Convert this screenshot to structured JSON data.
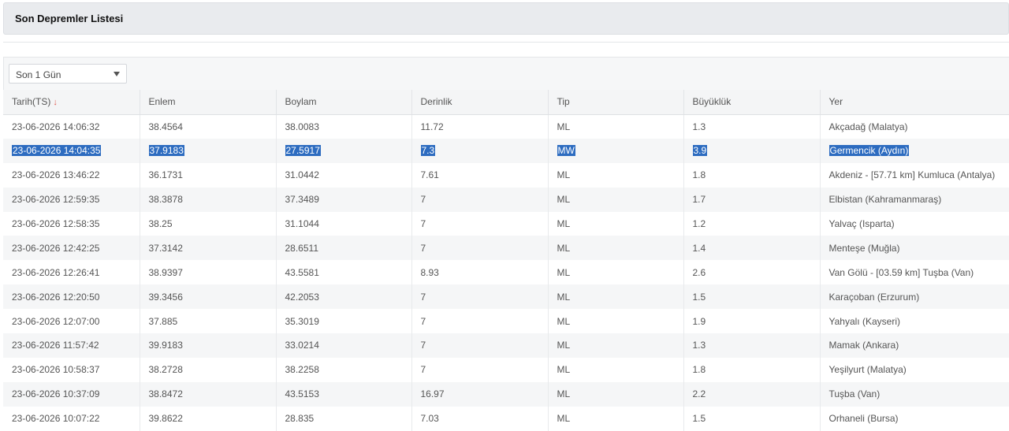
{
  "page": {
    "title": "Son Depremler Listesi"
  },
  "filter": {
    "selected": "Son 1 Gün"
  },
  "table": {
    "columns": [
      "Tarih(TS)",
      "Enlem",
      "Boylam",
      "Derinlik",
      "Tip",
      "Büyüklük",
      "Yer"
    ],
    "sort_indicator": "↓",
    "selected_row_index": 1,
    "colors": {
      "selection": "#2d6cc0",
      "sort_arrow": "#e05a4f"
    },
    "rows": [
      [
        "23-06-2026 14:06:32",
        "38.4564",
        "38.0083",
        "11.72",
        "ML",
        "1.3",
        "Akçadağ (Malatya)"
      ],
      [
        "23-06-2026 14:04:35",
        "37.9183",
        "27.5917",
        "7.3",
        "MW",
        "3.9",
        "Germencik (Aydın)"
      ],
      [
        "23-06-2026 13:46:22",
        "36.1731",
        "31.0442",
        "7.61",
        "ML",
        "1.8",
        "Akdeniz - [57.71 km] Kumluca (Antalya)"
      ],
      [
        "23-06-2026 12:59:35",
        "38.3878",
        "37.3489",
        "7",
        "ML",
        "1.7",
        "Elbistan (Kahramanmaraş)"
      ],
      [
        "23-06-2026 12:58:35",
        "38.25",
        "31.1044",
        "7",
        "ML",
        "1.2",
        "Yalvaç (Isparta)"
      ],
      [
        "23-06-2026 12:42:25",
        "37.3142",
        "28.6511",
        "7",
        "ML",
        "1.4",
        "Menteşe (Muğla)"
      ],
      [
        "23-06-2026 12:26:41",
        "38.9397",
        "43.5581",
        "8.93",
        "ML",
        "2.6",
        "Van Gölü - [03.59 km] Tuşba (Van)"
      ],
      [
        "23-06-2026 12:20:50",
        "39.3456",
        "42.2053",
        "7",
        "ML",
        "1.5",
        "Karaçoban (Erzurum)"
      ],
      [
        "23-06-2026 12:07:00",
        "37.885",
        "35.3019",
        "7",
        "ML",
        "1.9",
        "Yahyalı (Kayseri)"
      ],
      [
        "23-06-2026 11:57:42",
        "39.9183",
        "33.0214",
        "7",
        "ML",
        "1.3",
        "Mamak (Ankara)"
      ],
      [
        "23-06-2026 10:58:37",
        "38.2728",
        "38.2258",
        "7",
        "ML",
        "1.8",
        "Yeşilyurt (Malatya)"
      ],
      [
        "23-06-2026 10:37:09",
        "38.8472",
        "43.5153",
        "16.97",
        "ML",
        "2.2",
        "Tuşba (Van)"
      ],
      [
        "23-06-2026 10:07:22",
        "39.8622",
        "28.835",
        "7.03",
        "ML",
        "1.5",
        "Orhaneli (Bursa)"
      ]
    ]
  }
}
